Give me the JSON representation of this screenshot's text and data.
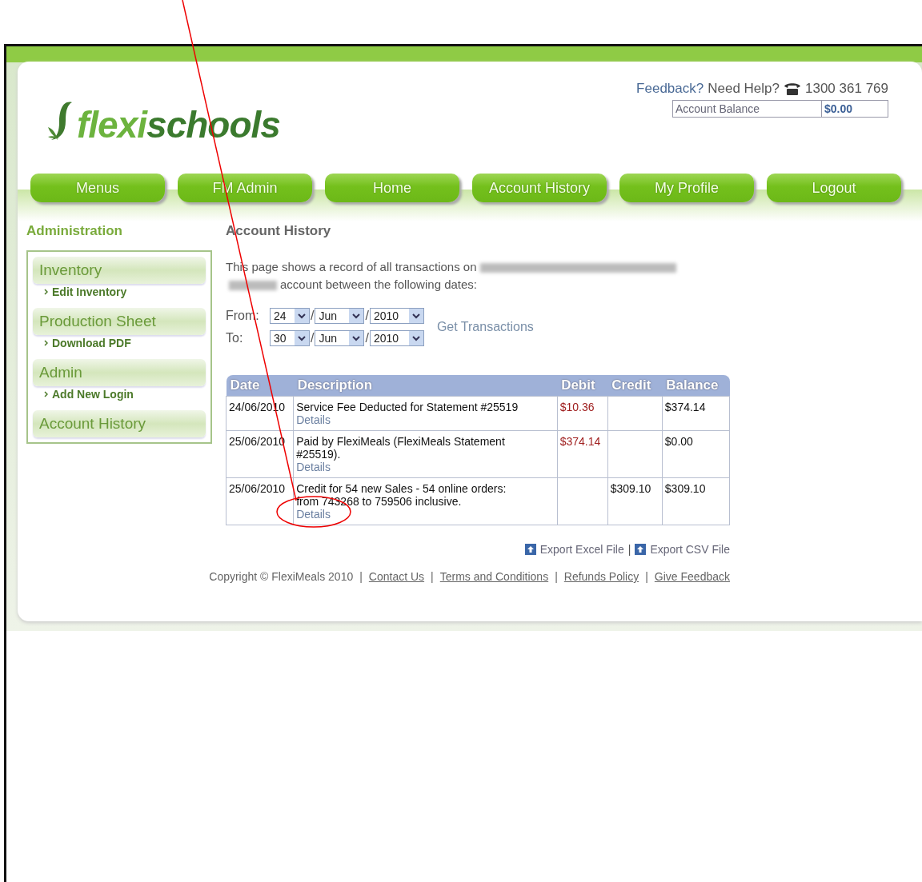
{
  "header": {
    "feedback": "Feedback?",
    "help": "Need Help?",
    "phone": "1300 361 769",
    "balance_label": "Account Balance",
    "balance_value": "$0.00"
  },
  "logo": {
    "part1": "flexi",
    "part2": "schools"
  },
  "nav": [
    {
      "label": "Menus"
    },
    {
      "label": "FM Admin"
    },
    {
      "label": "Home"
    },
    {
      "label": "Account History"
    },
    {
      "label": "My Profile"
    },
    {
      "label": "Logout"
    }
  ],
  "sidebar": {
    "title": "Administration",
    "sections": [
      {
        "heading": "Inventory",
        "links": [
          "Edit Inventory"
        ]
      },
      {
        "heading": "Production Sheet",
        "links": [
          "Download PDF"
        ]
      },
      {
        "heading": "Admin",
        "links": [
          "Add New Login"
        ]
      },
      {
        "heading": "Account History"
      }
    ]
  },
  "main": {
    "title": "Account History",
    "intro_start": "This page shows a record of all transactions on",
    "intro_end": "account between the following dates:",
    "get_transactions": "Get Transactions",
    "date_range": [
      {
        "label": "From:",
        "day": "24",
        "month": "Jun",
        "year": "2010",
        "separator": "/"
      },
      {
        "label": "To:",
        "day": "30",
        "month": "Jun",
        "year": "2010",
        "separator": "/"
      }
    ]
  },
  "table": {
    "columns": [
      "Date",
      "Description",
      "Debit",
      "Credit",
      "Balance"
    ],
    "rows": [
      {
        "date": "24/06/2010",
        "description": "Service Fee Deducted for Statement #25519",
        "details": "Details",
        "debit": "$10.36",
        "balance": "$374.14"
      },
      {
        "date": "25/06/2010",
        "description": "Paid by FlexiMeals (FlexiMeals Statement #25519).",
        "details": "Details",
        "debit": "$374.14",
        "balance": "$0.00"
      },
      {
        "date": "25/06/2010",
        "description": "Credit for 54 new Sales - 54 online orders: from 743268 to 759506 inclusive.",
        "details": "Details",
        "credit": "$309.10",
        "balance": "$309.10"
      }
    ]
  },
  "exports": {
    "items": [
      "Export Excel File",
      "Export CSV File"
    ],
    "separator": "|"
  },
  "footer": {
    "copyright": "Copyright © FlexiMeals 2010",
    "separator": "|",
    "links": [
      "Contact Us",
      "Terms and Conditions",
      "Refunds Policy",
      "Give Feedback"
    ]
  }
}
